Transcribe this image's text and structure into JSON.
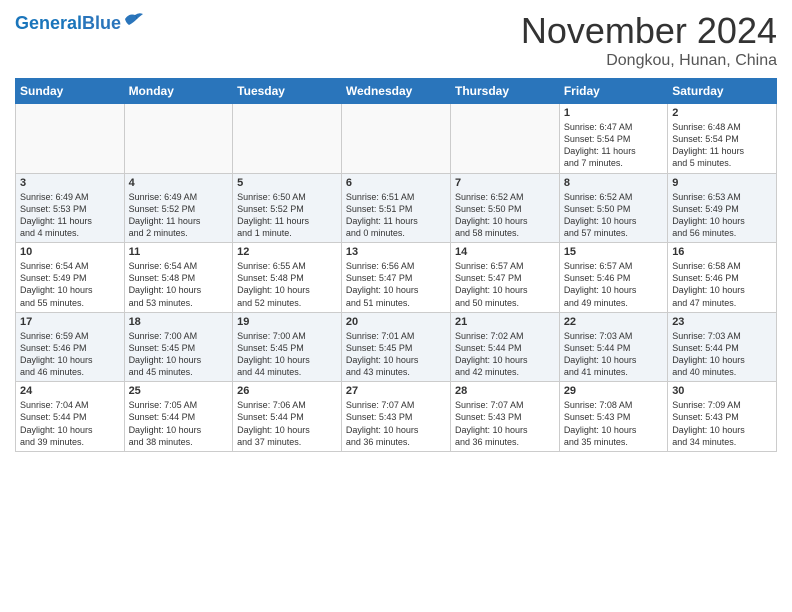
{
  "header": {
    "logo_general": "General",
    "logo_blue": "Blue",
    "month": "November 2024",
    "location": "Dongkou, Hunan, China"
  },
  "days_of_week": [
    "Sunday",
    "Monday",
    "Tuesday",
    "Wednesday",
    "Thursday",
    "Friday",
    "Saturday"
  ],
  "weeks": [
    [
      {
        "day": "",
        "info": ""
      },
      {
        "day": "",
        "info": ""
      },
      {
        "day": "",
        "info": ""
      },
      {
        "day": "",
        "info": ""
      },
      {
        "day": "",
        "info": ""
      },
      {
        "day": "1",
        "info": "Sunrise: 6:47 AM\nSunset: 5:54 PM\nDaylight: 11 hours\nand 7 minutes."
      },
      {
        "day": "2",
        "info": "Sunrise: 6:48 AM\nSunset: 5:54 PM\nDaylight: 11 hours\nand 5 minutes."
      }
    ],
    [
      {
        "day": "3",
        "info": "Sunrise: 6:49 AM\nSunset: 5:53 PM\nDaylight: 11 hours\nand 4 minutes."
      },
      {
        "day": "4",
        "info": "Sunrise: 6:49 AM\nSunset: 5:52 PM\nDaylight: 11 hours\nand 2 minutes."
      },
      {
        "day": "5",
        "info": "Sunrise: 6:50 AM\nSunset: 5:52 PM\nDaylight: 11 hours\nand 1 minute."
      },
      {
        "day": "6",
        "info": "Sunrise: 6:51 AM\nSunset: 5:51 PM\nDaylight: 11 hours\nand 0 minutes."
      },
      {
        "day": "7",
        "info": "Sunrise: 6:52 AM\nSunset: 5:50 PM\nDaylight: 10 hours\nand 58 minutes."
      },
      {
        "day": "8",
        "info": "Sunrise: 6:52 AM\nSunset: 5:50 PM\nDaylight: 10 hours\nand 57 minutes."
      },
      {
        "day": "9",
        "info": "Sunrise: 6:53 AM\nSunset: 5:49 PM\nDaylight: 10 hours\nand 56 minutes."
      }
    ],
    [
      {
        "day": "10",
        "info": "Sunrise: 6:54 AM\nSunset: 5:49 PM\nDaylight: 10 hours\nand 55 minutes."
      },
      {
        "day": "11",
        "info": "Sunrise: 6:54 AM\nSunset: 5:48 PM\nDaylight: 10 hours\nand 53 minutes."
      },
      {
        "day": "12",
        "info": "Sunrise: 6:55 AM\nSunset: 5:48 PM\nDaylight: 10 hours\nand 52 minutes."
      },
      {
        "day": "13",
        "info": "Sunrise: 6:56 AM\nSunset: 5:47 PM\nDaylight: 10 hours\nand 51 minutes."
      },
      {
        "day": "14",
        "info": "Sunrise: 6:57 AM\nSunset: 5:47 PM\nDaylight: 10 hours\nand 50 minutes."
      },
      {
        "day": "15",
        "info": "Sunrise: 6:57 AM\nSunset: 5:46 PM\nDaylight: 10 hours\nand 49 minutes."
      },
      {
        "day": "16",
        "info": "Sunrise: 6:58 AM\nSunset: 5:46 PM\nDaylight: 10 hours\nand 47 minutes."
      }
    ],
    [
      {
        "day": "17",
        "info": "Sunrise: 6:59 AM\nSunset: 5:46 PM\nDaylight: 10 hours\nand 46 minutes."
      },
      {
        "day": "18",
        "info": "Sunrise: 7:00 AM\nSunset: 5:45 PM\nDaylight: 10 hours\nand 45 minutes."
      },
      {
        "day": "19",
        "info": "Sunrise: 7:00 AM\nSunset: 5:45 PM\nDaylight: 10 hours\nand 44 minutes."
      },
      {
        "day": "20",
        "info": "Sunrise: 7:01 AM\nSunset: 5:45 PM\nDaylight: 10 hours\nand 43 minutes."
      },
      {
        "day": "21",
        "info": "Sunrise: 7:02 AM\nSunset: 5:44 PM\nDaylight: 10 hours\nand 42 minutes."
      },
      {
        "day": "22",
        "info": "Sunrise: 7:03 AM\nSunset: 5:44 PM\nDaylight: 10 hours\nand 41 minutes."
      },
      {
        "day": "23",
        "info": "Sunrise: 7:03 AM\nSunset: 5:44 PM\nDaylight: 10 hours\nand 40 minutes."
      }
    ],
    [
      {
        "day": "24",
        "info": "Sunrise: 7:04 AM\nSunset: 5:44 PM\nDaylight: 10 hours\nand 39 minutes."
      },
      {
        "day": "25",
        "info": "Sunrise: 7:05 AM\nSunset: 5:44 PM\nDaylight: 10 hours\nand 38 minutes."
      },
      {
        "day": "26",
        "info": "Sunrise: 7:06 AM\nSunset: 5:44 PM\nDaylight: 10 hours\nand 37 minutes."
      },
      {
        "day": "27",
        "info": "Sunrise: 7:07 AM\nSunset: 5:43 PM\nDaylight: 10 hours\nand 36 minutes."
      },
      {
        "day": "28",
        "info": "Sunrise: 7:07 AM\nSunset: 5:43 PM\nDaylight: 10 hours\nand 36 minutes."
      },
      {
        "day": "29",
        "info": "Sunrise: 7:08 AM\nSunset: 5:43 PM\nDaylight: 10 hours\nand 35 minutes."
      },
      {
        "day": "30",
        "info": "Sunrise: 7:09 AM\nSunset: 5:43 PM\nDaylight: 10 hours\nand 34 minutes."
      }
    ]
  ]
}
